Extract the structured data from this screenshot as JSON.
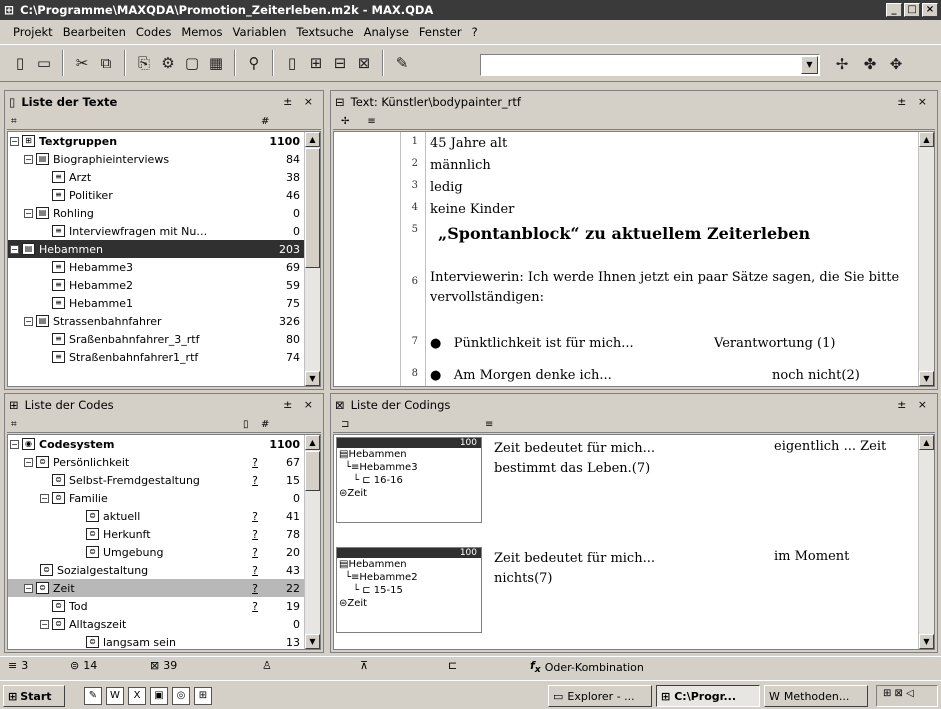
{
  "window": {
    "title": "C:\\Programme\\MAXQDA\\Promotion_Zeiterleben.m2k - MAX.QDA",
    "min": "_",
    "max": "□",
    "close": "×"
  },
  "menu": [
    "Projekt",
    "Bearbeiten",
    "Codes",
    "Memos",
    "Variablen",
    "Textsuche",
    "Analyse",
    "Fenster",
    "?"
  ],
  "texts_panel": {
    "title": "Liste der Texte",
    "col1": "⌗",
    "col2": "#",
    "controls": "± ×",
    "rows": [
      {
        "label": "Textgruppen",
        "count": "1100",
        "bold": true
      },
      {
        "label": "Biographieinterviews",
        "count": "84"
      },
      {
        "label": "Arzt",
        "count": "38"
      },
      {
        "label": "Politiker",
        "count": "46"
      },
      {
        "label": "Rohling",
        "count": "0"
      },
      {
        "label": "Interviewfragen mit Nu…",
        "count": "0"
      },
      {
        "label": "Hebammen",
        "count": "203"
      },
      {
        "label": "Hebamme3",
        "count": "69"
      },
      {
        "label": "Hebamme2",
        "count": "59"
      },
      {
        "label": "Hebamme1",
        "count": "75"
      },
      {
        "label": "Strassenbahnfahrer",
        "count": "326"
      },
      {
        "label": "Sraßenbahnfahrer_3_rtf",
        "count": "80"
      },
      {
        "label": "Straßenbahnfahrer1_rtf",
        "count": "74"
      }
    ]
  },
  "codes_panel": {
    "title": "Liste der Codes",
    "col1": "⌗",
    "col2": "#",
    "controls": "± ×",
    "rows": [
      {
        "label": "Codesystem",
        "count": "1100",
        "bold": true,
        "q": ""
      },
      {
        "label": "Persönlichkeit",
        "count": "67",
        "q": "?"
      },
      {
        "label": "Selbst-Fremdgestaltung",
        "count": "15",
        "q": "?"
      },
      {
        "label": "Familie",
        "count": "0",
        "q": ""
      },
      {
        "label": "aktuell",
        "count": "41",
        "q": "?"
      },
      {
        "label": "Herkunft",
        "count": "78",
        "q": "?"
      },
      {
        "label": "Umgebung",
        "count": "20",
        "q": "?"
      },
      {
        "label": "Sozialgestaltung",
        "count": "43",
        "q": "?"
      },
      {
        "label": "Zeit",
        "count": "22",
        "q": "?"
      },
      {
        "label": "Tod",
        "count": "19",
        "q": "?"
      },
      {
        "label": "Alltagszeit",
        "count": "0",
        "q": ""
      },
      {
        "label": "langsam sein",
        "count": "13",
        "q": ""
      }
    ]
  },
  "text_panel": {
    "title": "Text: Künstler\\bodypainter_rtf",
    "controls": "± ×",
    "lines": [
      {
        "n": "1",
        "t": "45 Jahre alt"
      },
      {
        "n": "2",
        "t": "männlich"
      },
      {
        "n": "3",
        "t": "ledig"
      },
      {
        "n": "4",
        "t": "keine Kinder"
      },
      {
        "n": "5",
        "t": "„Spontanblock“ zu aktuellem Zeiterleben"
      },
      {
        "n": "6",
        "t": "Interviewerin: Ich werde Ihnen jetzt ein paar Sätze sagen, die Sie bitte vervollständigen:"
      },
      {
        "n": "7",
        "t": "Pünktlichkeit ist für mich...",
        "r": "Verantwortung (1)"
      },
      {
        "n": "8",
        "t": "Am Morgen denke ich...",
        "r": "noch nicht(2)"
      }
    ]
  },
  "codings_panel": {
    "title": "Liste der Codings",
    "controls": "± ×",
    "items": [
      {
        "weight": "100",
        "group": "Hebammen",
        "text": "Hebamme3",
        "range": "16-16",
        "code": "Zeit",
        "body": "Zeit bedeutet für mich...",
        "right": "eigentlich ... Zeit",
        "cont": "bestimmt das Leben.(7)"
      },
      {
        "weight": "100",
        "group": "Hebammen",
        "text": "Hebamme2",
        "range": "15-15",
        "code": "Zeit",
        "body": "Zeit bedeutet für mich...",
        "right": "im Moment",
        "cont": "nichts(7)"
      }
    ]
  },
  "status": {
    "texts": "3",
    "codes": "14",
    "codings": "39",
    "mode": "Oder-Kombination"
  },
  "taskbar": {
    "start": "Start",
    "tasks": [
      "Explorer - ...",
      "C:\\Progr...",
      "Methoden..."
    ]
  }
}
